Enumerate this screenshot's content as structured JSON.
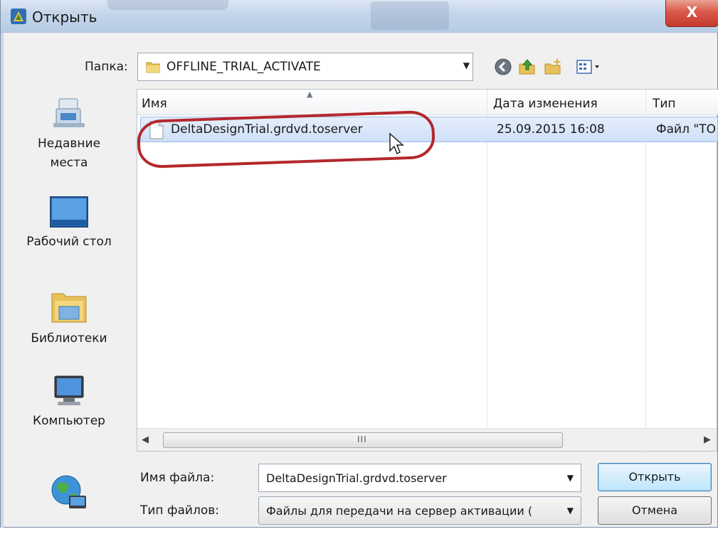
{
  "window": {
    "title": "Открыть",
    "close_glyph": "X",
    "accent_color": "#c53a2c"
  },
  "toolbar": {
    "folder_label": "Папка:",
    "current_folder": "OFFLINE_TRIAL_ACTIVATE",
    "icons": [
      "back-icon",
      "up-folder-icon",
      "new-folder-icon",
      "view-menu-icon"
    ]
  },
  "places": [
    {
      "label_line1": "Недавние",
      "label_line2": "места",
      "icon": "recent-places-icon"
    },
    {
      "label_line1": "Рабочий стол",
      "label_line2": "",
      "icon": "desktop-icon"
    },
    {
      "label_line1": "Библиотеки",
      "label_line2": "",
      "icon": "libraries-icon"
    },
    {
      "label_line1": "Компьютер",
      "label_line2": "",
      "icon": "computer-icon"
    },
    {
      "label_line1": "",
      "label_line2": "",
      "icon": "network-icon"
    }
  ],
  "filelist": {
    "columns": [
      "Имя",
      "Дата изменения",
      "Тип"
    ],
    "rows": [
      {
        "name": "DeltaDesignTrial.grdvd.toserver",
        "date": "25.09.2015 16:08",
        "type": "Файл \"TO"
      }
    ],
    "scroll_grip": "III"
  },
  "form": {
    "filename_label": "Имя файла:",
    "filename_value": "DeltaDesignTrial.grdvd.toserver",
    "filetype_label": "Тип файлов:",
    "filetype_value": "Файлы для передачи на сервер активации (",
    "open_button": "Открыть",
    "cancel_button": "Отмена"
  }
}
